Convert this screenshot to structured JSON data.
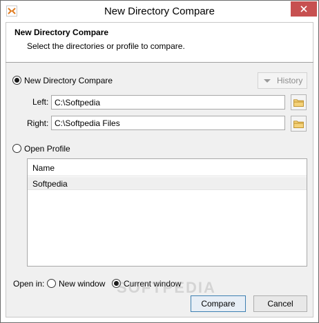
{
  "window": {
    "title": "New Directory Compare",
    "close_glyph": "✕",
    "app_icon": "compare-app-icon"
  },
  "header": {
    "title": "New Directory Compare",
    "subtitle": "Select the directories or profile to compare."
  },
  "compare_option": {
    "label": "New Directory Compare",
    "selected": true
  },
  "history_button": {
    "label": "History",
    "enabled": false
  },
  "left": {
    "label": "Left:",
    "value": "C:\\Softpedia",
    "browse_icon": "folder-icon"
  },
  "right": {
    "label": "Right:",
    "value": "C:\\Softpedia Files",
    "browse_icon": "folder-icon"
  },
  "profile_option": {
    "label": "Open Profile",
    "selected": false
  },
  "profile_list": {
    "columns": [
      "Name"
    ],
    "rows": [
      "Softpedia"
    ]
  },
  "open_in": {
    "label": "Open in:",
    "options": [
      {
        "label": "New window",
        "selected": false
      },
      {
        "label": "Current window",
        "selected": true
      }
    ]
  },
  "buttons": {
    "compare": "Compare",
    "cancel": "Cancel"
  },
  "watermark": "SOFTPEDIA",
  "colors": {
    "close_button": "#c75050",
    "panel_bg": "#f0f0f0",
    "folder": "#e8c15a"
  }
}
